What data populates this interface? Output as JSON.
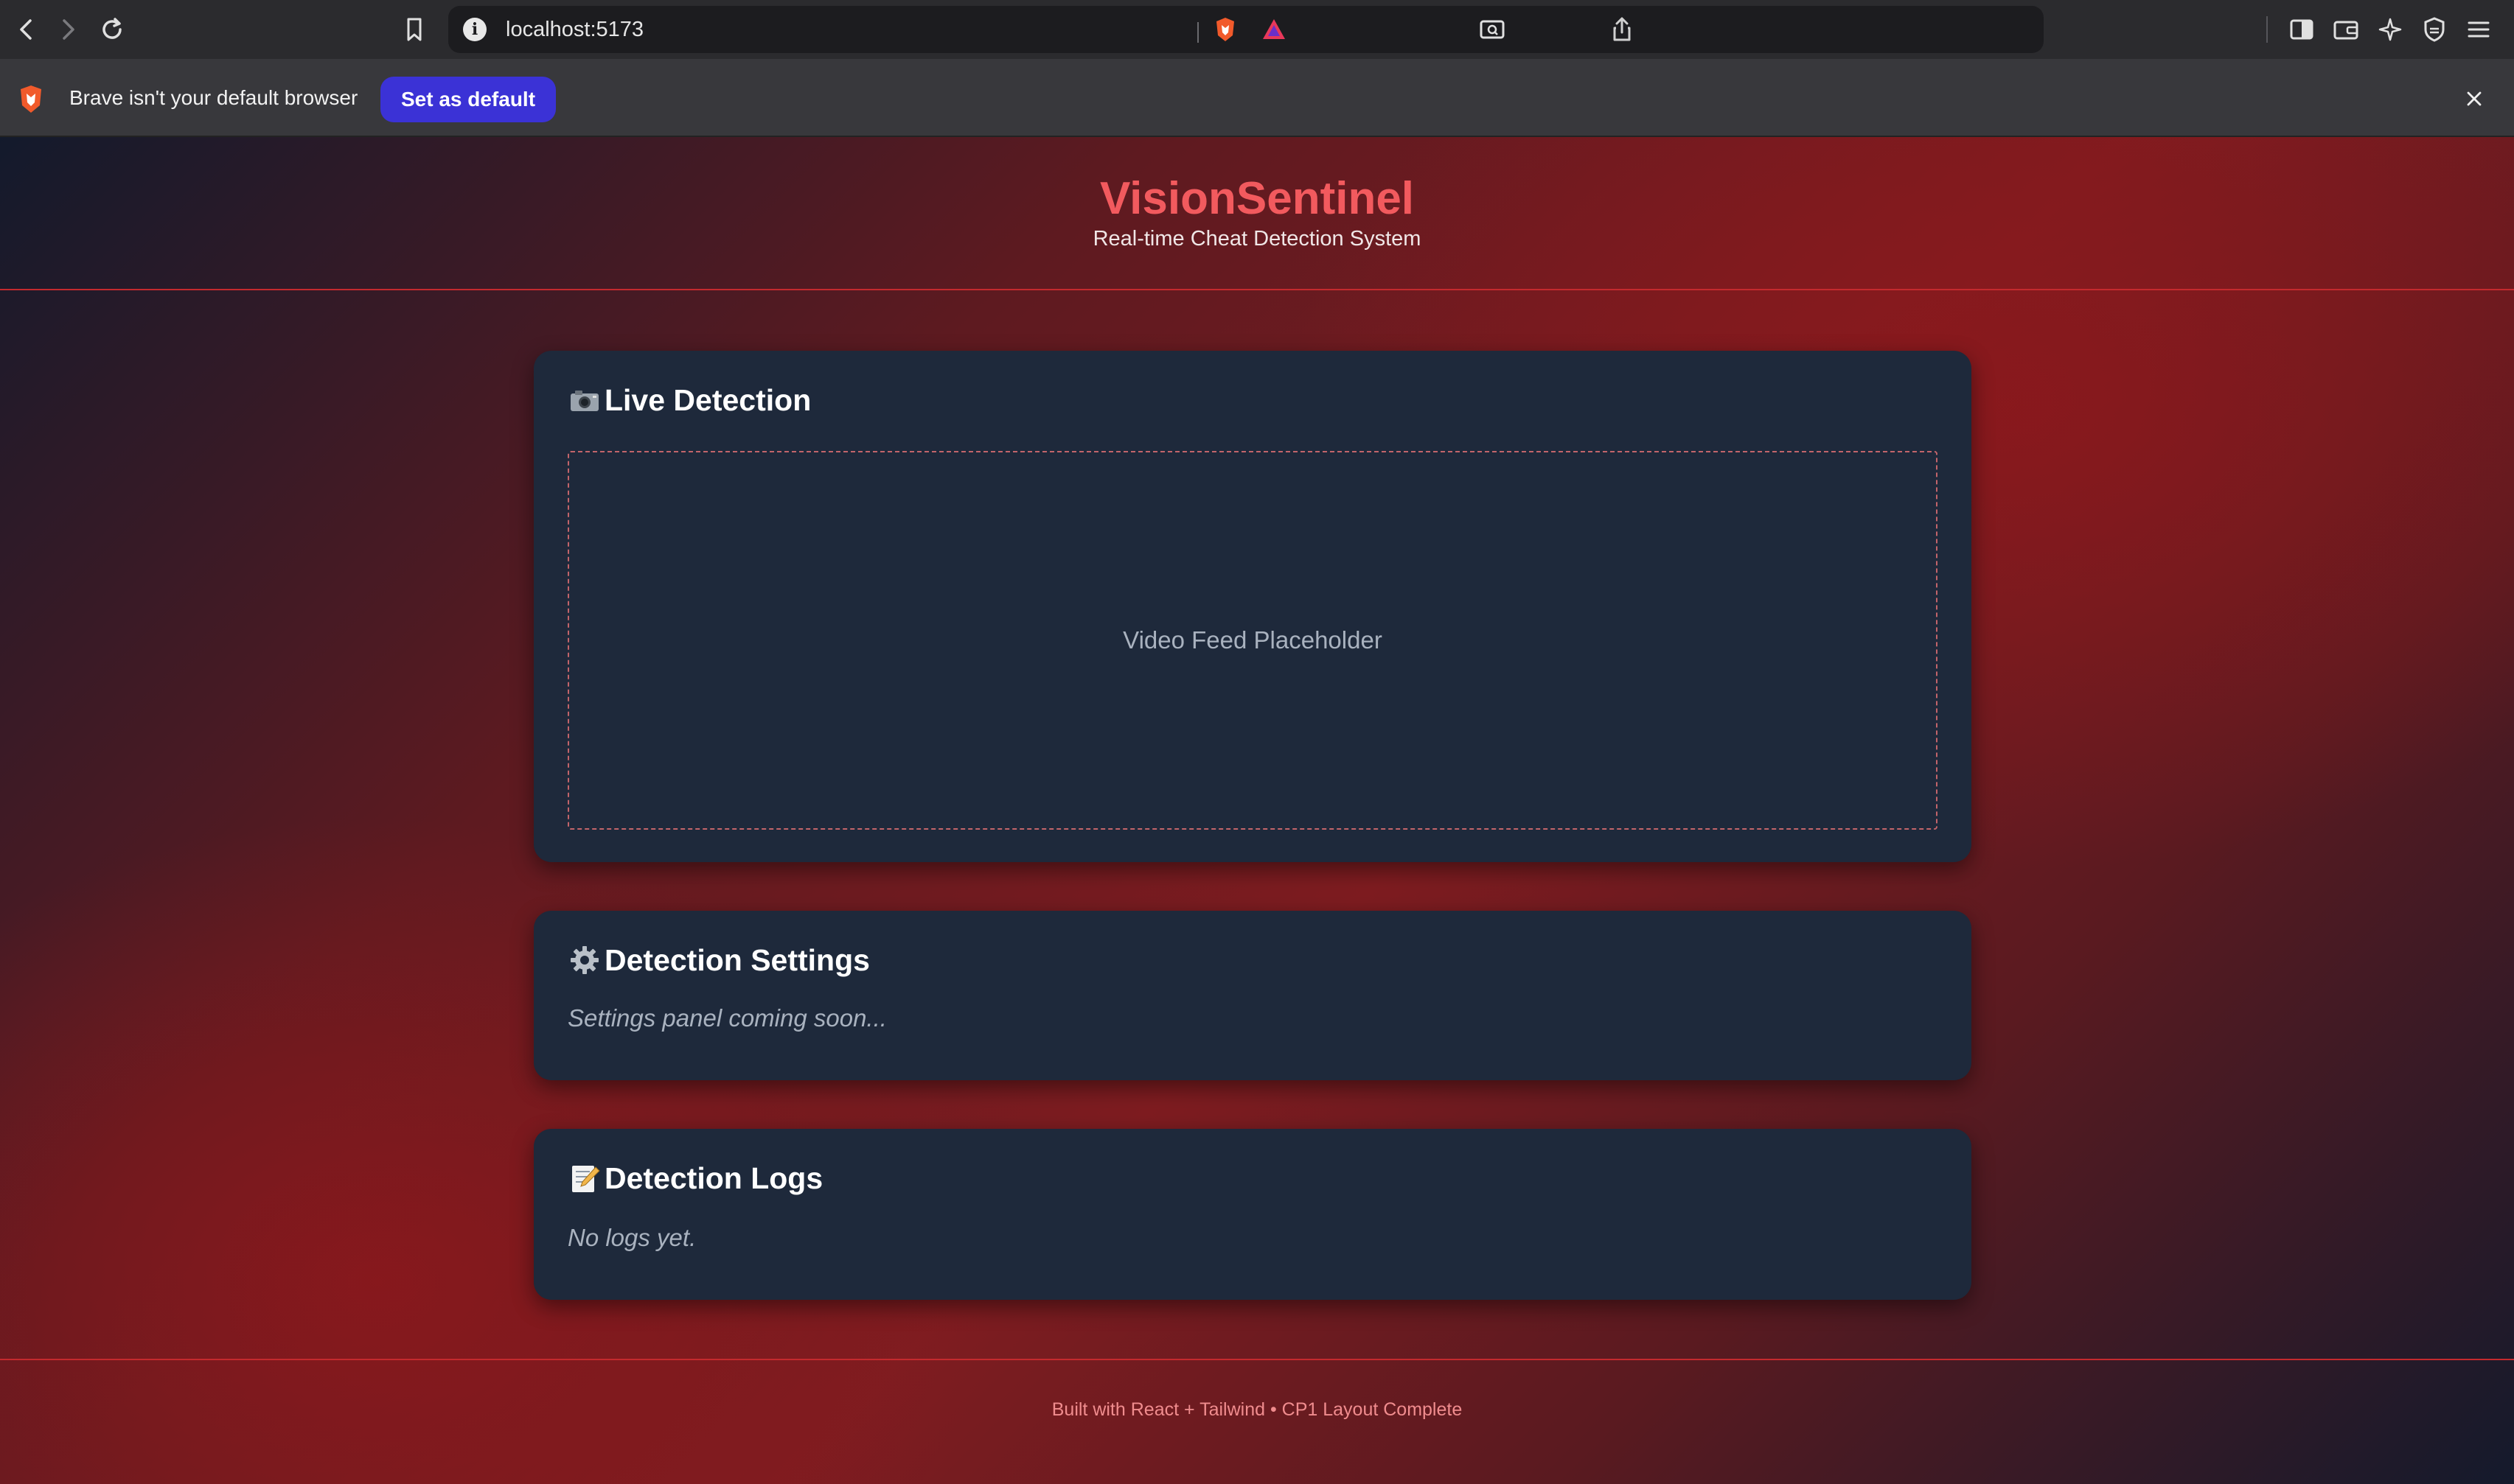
{
  "browser": {
    "url": "localhost:5173",
    "infobar": {
      "message": "Brave isn't your default browser",
      "button_label": "Set as default"
    }
  },
  "header": {
    "title": "VisionSentinel",
    "subtitle": "Real-time Cheat Detection System"
  },
  "sections": {
    "live": {
      "title": "Live Detection",
      "icon": "camera-icon",
      "video_placeholder": "Video Feed Placeholder"
    },
    "settings": {
      "title": "Detection Settings",
      "icon": "gear-icon",
      "note": "Settings panel coming soon..."
    },
    "logs": {
      "title": "Detection Logs",
      "icon": "memo-icon",
      "note": "No logs yet."
    }
  },
  "footer": {
    "text": "Built with React + Tailwind • CP1 Layout Complete"
  },
  "colors": {
    "accent_title": "#f25a5e",
    "card_bg": "#1e293b",
    "button_bg": "#3b32d6",
    "divider": "#c42a2e"
  }
}
